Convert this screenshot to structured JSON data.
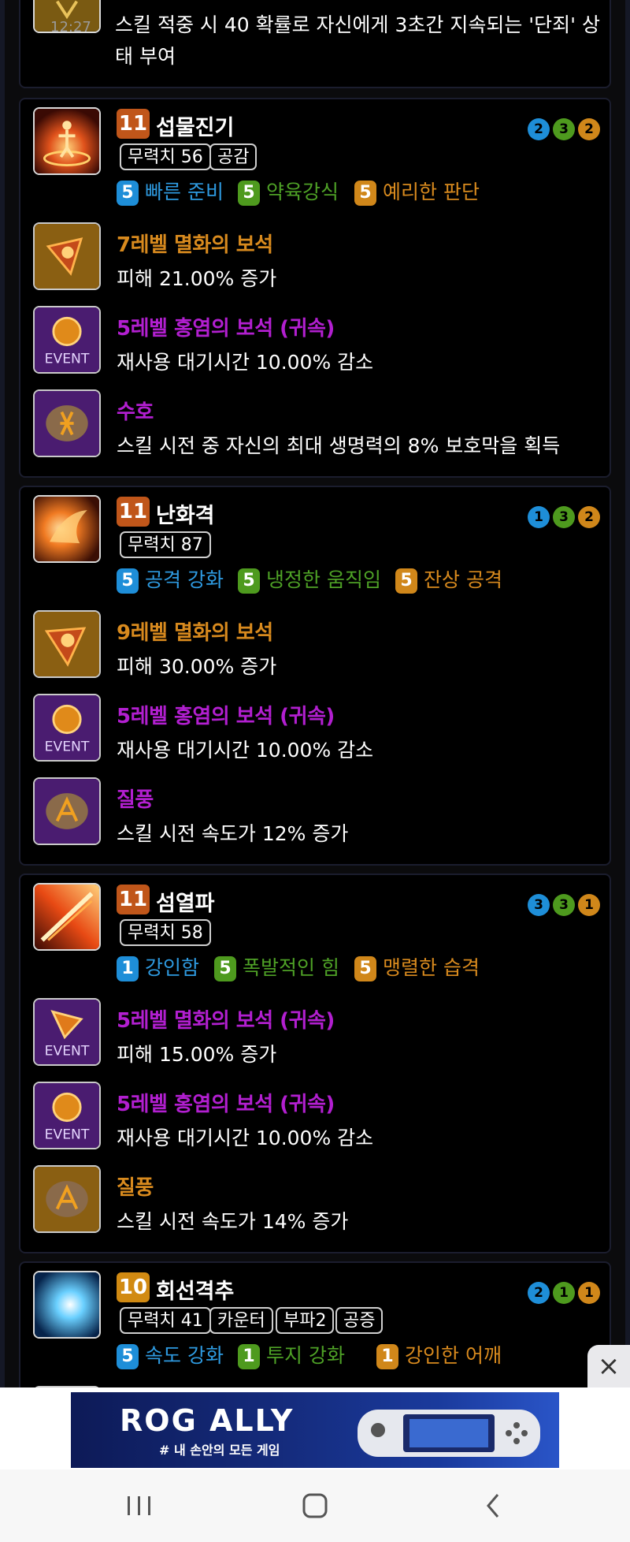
{
  "top_card": {
    "desc_line1": "스킬 적중 시 40 확률로 자신에게 3초간 지속되는 '단죄' 상",
    "desc_line2": "태 부여",
    "time_overlay": "12:27"
  },
  "skills": [
    {
      "level": "11",
      "name": "섭물진기",
      "tags": [
        "무력치 56",
        "공감"
      ],
      "dots": [
        "2",
        "3",
        "2"
      ],
      "tripods": [
        {
          "n": "5",
          "label": "빠른 준비"
        },
        {
          "n": "5",
          "label": "약육강식"
        },
        {
          "n": "5",
          "label": "예리한 판단"
        }
      ],
      "gems": [
        {
          "title": "7레벨 멸화의 보석",
          "desc": "피해 21.00% 증가"
        },
        {
          "title": "5레벨 홍염의 보석 (귀속)",
          "desc": "재사용 대기시간 10.00% 감소",
          "event": "EVENT"
        },
        {
          "title": "수호",
          "desc": "스킬 시전 중 자신의 최대 생명력의 8% 보호막을 획득"
        }
      ]
    },
    {
      "level": "11",
      "name": "난화격",
      "tags": [
        "무력치 87"
      ],
      "dots": [
        "1",
        "3",
        "2"
      ],
      "tripods": [
        {
          "n": "5",
          "label": "공격 강화"
        },
        {
          "n": "5",
          "label": "냉정한 움직임"
        },
        {
          "n": "5",
          "label": "잔상 공격"
        }
      ],
      "gems": [
        {
          "title": "9레벨 멸화의 보석",
          "desc": "피해 30.00% 증가"
        },
        {
          "title": "5레벨 홍염의 보석 (귀속)",
          "desc": "재사용 대기시간 10.00% 감소",
          "event": "EVENT"
        },
        {
          "title": "질풍",
          "desc": "스킬 시전 속도가 12% 증가"
        }
      ]
    },
    {
      "level": "11",
      "name": "섬열파",
      "tags": [
        "무력치 58"
      ],
      "dots": [
        "3",
        "3",
        "1"
      ],
      "tripods": [
        {
          "n": "1",
          "label": "강인함"
        },
        {
          "n": "5",
          "label": "폭발적인 힘"
        },
        {
          "n": "5",
          "label": "맹렬한 습격"
        }
      ],
      "gems": [
        {
          "title": "5레벨 멸화의 보석 (귀속)",
          "desc": "피해 15.00% 증가",
          "event": "EVENT"
        },
        {
          "title": "5레벨 홍염의 보석 (귀속)",
          "desc": "재사용 대기시간 10.00% 감소",
          "event": "EVENT"
        },
        {
          "title": "질풍",
          "desc": "스킬 시전 속도가 14% 증가"
        }
      ]
    },
    {
      "level": "10",
      "name": "회선격추",
      "tags": [
        "무력치 41",
        "카운터",
        "부파2",
        "공증"
      ],
      "dots": [
        "2",
        "1",
        "1"
      ],
      "tripods": [
        {
          "n": "5",
          "label": "속도 강화"
        },
        {
          "n": "1",
          "label": "투지 강화"
        },
        {
          "n": "1",
          "label": "강인한 어깨"
        }
      ]
    }
  ],
  "ad": {
    "brand": "ROG ALLY",
    "slogan": "# 내 손안의 모든 게임",
    "close_icon": "×"
  },
  "colors": {
    "tier1": "#1e8ed8",
    "tier2": "#4e9a1e",
    "tier3": "#d0871a",
    "orange_gem": "#d88a1e",
    "purple_gem": "#b21fd0",
    "level": "#c0561a"
  }
}
